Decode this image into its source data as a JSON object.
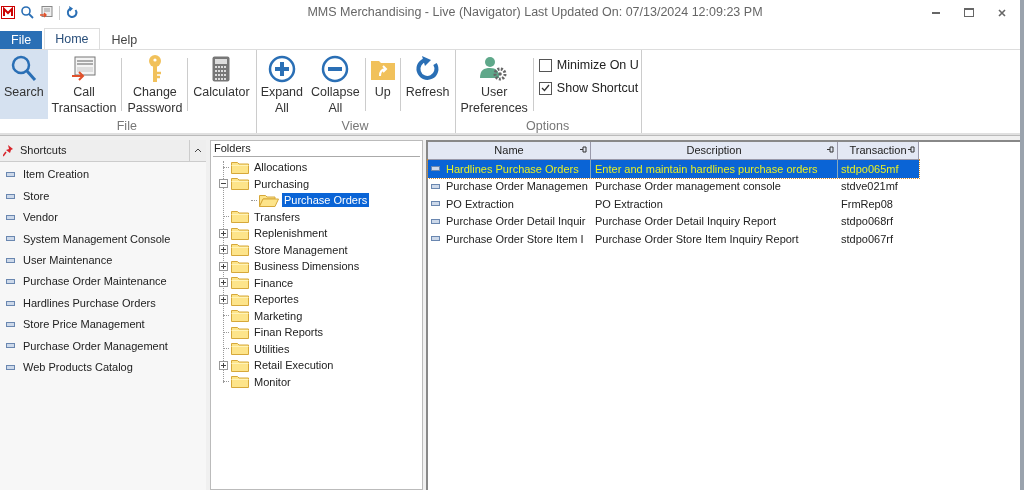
{
  "window": {
    "title": "MMS Merchandising - Live (Navigator) Last Updated On: 07/13/2024 12:09:23 PM"
  },
  "menu_tabs": [
    {
      "label": "File",
      "kind": "file",
      "selected": false
    },
    {
      "label": "Home",
      "kind": "tab",
      "selected": true
    },
    {
      "label": "Help",
      "kind": "tab",
      "selected": false
    }
  ],
  "ribbon_groups": [
    {
      "label": "File",
      "items": [
        {
          "kind": "button",
          "label": "Search",
          "selected": true
        },
        {
          "kind": "button",
          "label": "Call Transaction",
          "selected": false
        },
        {
          "kind": "separator"
        },
        {
          "kind": "button",
          "label": "Change Password",
          "selected": false
        },
        {
          "kind": "separator"
        },
        {
          "kind": "button",
          "label": "Calculator",
          "selected": false
        }
      ]
    },
    {
      "label": "View",
      "items": [
        {
          "kind": "button",
          "label": "Expand All",
          "selected": false
        },
        {
          "kind": "button",
          "label": "Collapse All",
          "selected": false
        },
        {
          "kind": "separator"
        },
        {
          "kind": "button",
          "label": "Up",
          "selected": false
        },
        {
          "kind": "separator"
        },
        {
          "kind": "button",
          "label": "Refresh",
          "selected": false
        }
      ]
    },
    {
      "label": "Options",
      "items": [
        {
          "kind": "button",
          "label": "User Preferences",
          "selected": false
        },
        {
          "kind": "separator"
        },
        {
          "kind": "checks",
          "checks": [
            {
              "label": "Minimize On U",
              "checked": false
            },
            {
              "label": "Show Shortcut",
              "checked": true
            }
          ]
        }
      ]
    }
  ],
  "shortcuts": {
    "title": "Shortcuts",
    "items": [
      "Item Creation",
      "Store",
      "Vendor",
      "System Management Console",
      "User Maintenance",
      "Purchase Order Maintenance",
      "Hardlines Purchase Orders",
      "Store Price Management",
      "Purchase Order Management",
      "Web Products Catalog"
    ]
  },
  "folders": {
    "title": "Folders",
    "items": [
      {
        "label": "Allocations",
        "selected": false
      },
      {
        "label": "Purchasing",
        "selected": false,
        "expanded": true,
        "children": [
          {
            "label": "Purchase Orders",
            "selected": true
          }
        ]
      },
      {
        "label": "Transfers",
        "selected": false
      },
      {
        "label": "Replenishment",
        "selected": false,
        "expanded": false
      },
      {
        "label": "Store Management",
        "selected": false,
        "expanded": false
      },
      {
        "label": "Business Dimensions",
        "selected": false,
        "expanded": false
      },
      {
        "label": "Finance",
        "selected": false,
        "expanded": false
      },
      {
        "label": "Reportes",
        "selected": false,
        "expanded": false
      },
      {
        "label": "Marketing",
        "selected": false
      },
      {
        "label": "Finan Reports",
        "selected": false
      },
      {
        "label": "Utilities",
        "selected": false
      },
      {
        "label": "Retail Execution",
        "selected": false,
        "expanded": false
      },
      {
        "label": "Monitor",
        "selected": false
      }
    ]
  },
  "table": {
    "columns": [
      "Name",
      "Description",
      "Transaction"
    ],
    "rows": [
      {
        "cells": [
          "Hardlines Purchase Orders",
          "Enter and maintain hardlines purchase orders",
          "stdpo065mf"
        ],
        "selected": true
      },
      {
        "cells": [
          "Purchase Order Managemen",
          "Purchase Order management console",
          "stdve021mf"
        ],
        "selected": false
      },
      {
        "cells": [
          "PO Extraction",
          "PO Extraction",
          "FrmRep08"
        ],
        "selected": false
      },
      {
        "cells": [
          "Purchase Order Detail Inquir",
          "Purchase Order Detail Inquiry Report",
          "stdpo068rf"
        ],
        "selected": false
      },
      {
        "cells": [
          "Purchase Order Store Item I",
          "Purchase Order Store Item Inquiry Report",
          "stdpo067rf"
        ],
        "selected": false
      }
    ]
  }
}
